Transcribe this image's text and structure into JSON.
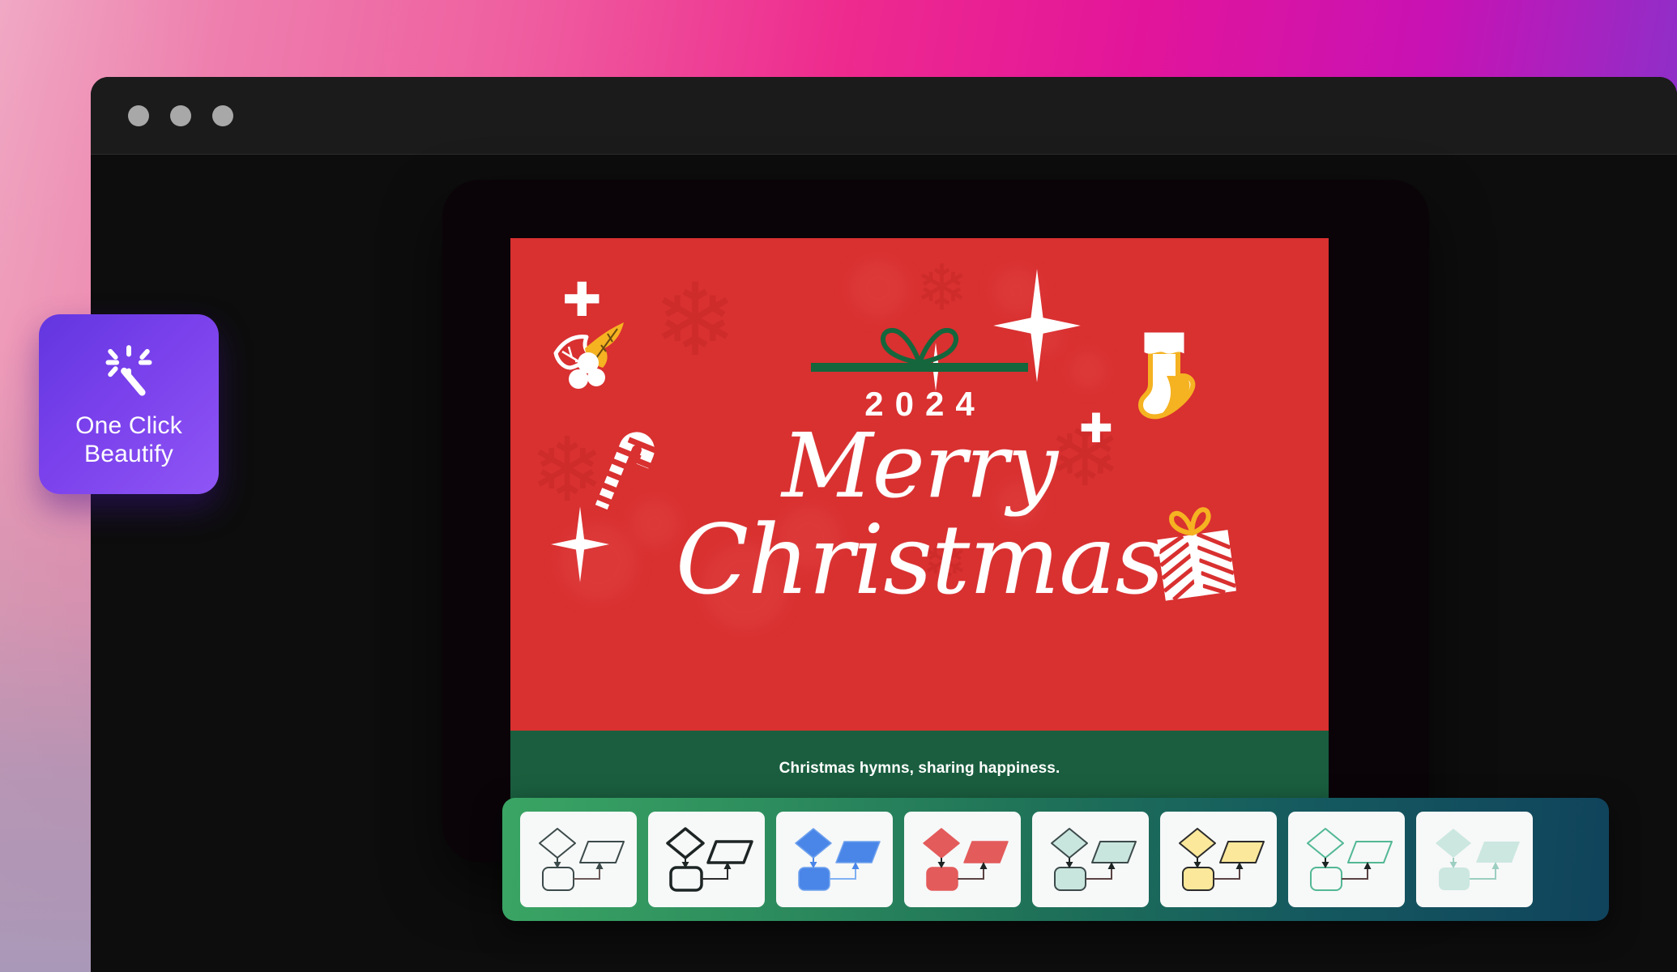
{
  "backdrop": {
    "gradient_from": "#f0a9c4",
    "gradient_mid": "#ee2a8e",
    "gradient_to": "#7b36cc"
  },
  "window": {
    "titlebar": {
      "dots": [
        {
          "name": "close-dot",
          "color": "#a8a8a8"
        },
        {
          "name": "minimize-dot",
          "color": "#a8a8a8"
        },
        {
          "name": "maximize-dot",
          "color": "#a8a8a8"
        }
      ]
    },
    "canvas_bg": "#0d0d0d"
  },
  "beautify_button": {
    "icon": "sparkle-wand-icon",
    "line1": "One Click",
    "line2": "Beautify",
    "accent": "#7a41ec"
  },
  "card": {
    "background": "#d93030",
    "ribbon_color": "#15663c",
    "bow_icon": "gift-bow-icon",
    "year": "2024",
    "greeting_line1": "Merry",
    "greeting_line2": "Christmas",
    "decorations": [
      "holly-icon",
      "candy-cane-icon",
      "stocking-icon",
      "gift-box-icon",
      "snowflake-icon",
      "sparkle-star-icon",
      "sparkle-plus-icon"
    ]
  },
  "footer": {
    "background": "#1a5e3f",
    "text": "Christmas hymns, sharing happiness."
  },
  "strip": {
    "gradient_from": "#3aa564",
    "gradient_to": "#10435c",
    "thumbnails": [
      {
        "name": "style-outline-thin",
        "fill": "none",
        "stroke": "#3c4a4a",
        "stroke_width": 2,
        "arrow": "#3c4a4a",
        "link": "#6b5a58"
      },
      {
        "name": "style-outline-bold",
        "fill": "none",
        "stroke": "#1d2424",
        "stroke_width": 3.5,
        "arrow": "#1d2424",
        "link": "#2a2a2a"
      },
      {
        "name": "style-blue-solid",
        "fill": "#4a86e8",
        "stroke": "#6fa2ee",
        "stroke_width": 1.5,
        "arrow": "#4a86e8",
        "link": "#7fb0f2"
      },
      {
        "name": "style-red-solid",
        "fill": "#e35b5b",
        "stroke": "#e35b5b",
        "stroke_width": 1.5,
        "arrow": "#1d2424",
        "link": "#5a4242"
      },
      {
        "name": "style-mint-solid",
        "fill": "#c9e6de",
        "stroke": "#3c4a4a",
        "stroke_width": 2,
        "arrow": "#1d2424",
        "link": "#5a4242"
      },
      {
        "name": "style-yellow-solid",
        "fill": "#fbe89a",
        "stroke": "#2b2b2b",
        "stroke_width": 2,
        "arrow": "#1d2424",
        "link": "#5a4242"
      },
      {
        "name": "style-mint-outline",
        "fill": "none",
        "stroke": "#52b894",
        "stroke_width": 2,
        "arrow": "#1d2424",
        "link": "#5a4242"
      },
      {
        "name": "style-mint-flat",
        "fill": "#cbe7e0",
        "stroke": "none",
        "stroke_width": 0,
        "arrow": "#9ccfc1",
        "link": "#9ccfc1"
      }
    ]
  }
}
